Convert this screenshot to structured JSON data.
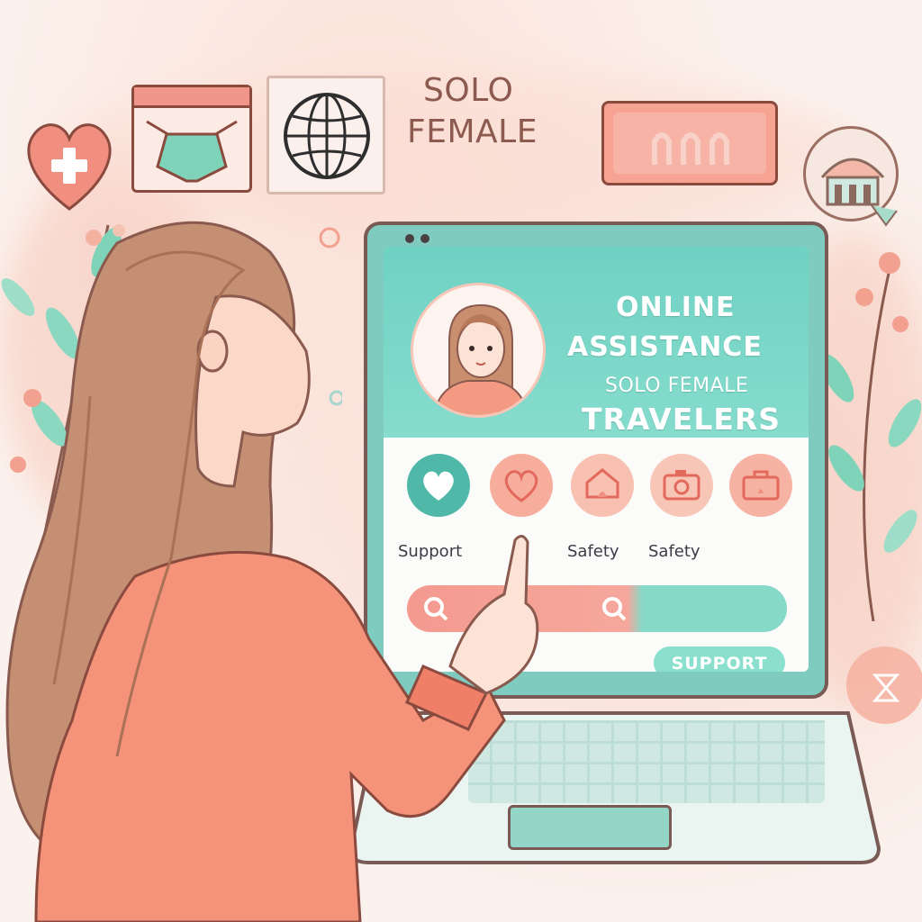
{
  "banner": {
    "title_line1": "SOLO",
    "title_line2": "FEMALE"
  },
  "screen": {
    "heading_line1": "ONLINE",
    "heading_line2": "ASSISTANCE",
    "heading_line3": "SOLO FEMALE",
    "heading_line4": "TRAVELERS",
    "categories": [
      {
        "label": "Support",
        "icon": "heart-icon"
      },
      {
        "label": "",
        "icon": "heart-outline-icon"
      },
      {
        "label": "Safety",
        "icon": "home-icon"
      },
      {
        "label": "Safety",
        "icon": "camera-icon"
      },
      {
        "label": "",
        "icon": "briefcase-icon"
      }
    ],
    "search_icon": "search-icon",
    "support_button": "SUPPORT"
  },
  "colors": {
    "teal": "#7fcbbf",
    "coral": "#f49a90",
    "outline": "#8a4a3e"
  }
}
